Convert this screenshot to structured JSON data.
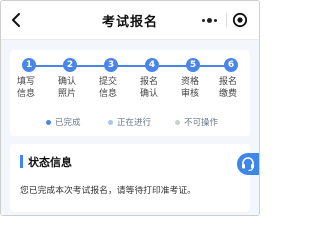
{
  "header": {
    "title": "考试报名",
    "back_icon": "chevron-left-icon",
    "more_icon": "more-dots-icon",
    "close_icon": "target-close-icon"
  },
  "steps": [
    {
      "num": "1",
      "label": "填写信息"
    },
    {
      "num": "2",
      "label": "确认照片"
    },
    {
      "num": "3",
      "label": "提交信息"
    },
    {
      "num": "4",
      "label": "报名确认"
    },
    {
      "num": "5",
      "label": "资格审核"
    },
    {
      "num": "6",
      "label": "报名缴费"
    }
  ],
  "legend": [
    {
      "label": "已完成",
      "color": "#4a86e8"
    },
    {
      "label": "正在进行",
      "color": "#a9c6ef"
    },
    {
      "label": "不可操作",
      "color": "#c8ced6"
    }
  ],
  "colors": {
    "accent": "#3f86ea"
  },
  "status": {
    "title": "状态信息",
    "message": "您已完成本次考试报名，请等待打印准考证。"
  }
}
